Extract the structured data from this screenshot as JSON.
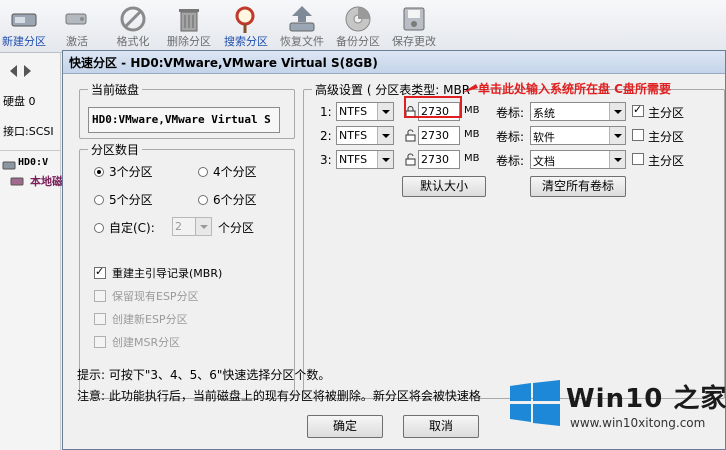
{
  "toolbar": {
    "items": [
      {
        "label": "新建分区",
        "icon": "new-partition-icon"
      },
      {
        "label": "激活",
        "icon": "activate-icon"
      },
      {
        "label": "格式化",
        "icon": "format-icon"
      },
      {
        "label": "删除分区",
        "icon": "delete-icon"
      },
      {
        "label": "搜索分区",
        "icon": "search-icon"
      },
      {
        "label": "恢复文件",
        "icon": "restore-icon"
      },
      {
        "label": "备份分区",
        "icon": "backup-icon"
      },
      {
        "label": "保存更改",
        "icon": "save-icon"
      }
    ]
  },
  "left_pane": {
    "disk_label": "硬盘 0",
    "interface_label": "接口:SCSI",
    "tree_disk": "HD0:V",
    "tree_local": "本地磁"
  },
  "dialog": {
    "title": "快速分区 - HD0:VMware,VMware Virtual S(8GB)",
    "current_disk": {
      "label": "当前磁盘",
      "value": "HD0:VMware,VMware Virtual S"
    },
    "partition_count": {
      "label": "分区数目",
      "options": [
        "3个分区",
        "4个分区",
        "5个分区",
        "6个分区"
      ],
      "selected": "3个分区",
      "custom_label": "自定(C):",
      "custom_value": "2",
      "custom_suffix": "个分区"
    },
    "options": [
      {
        "label": "重建主引导记录(MBR)",
        "checked": true,
        "enabled": true
      },
      {
        "label": "保留现有ESP分区",
        "checked": false,
        "enabled": false
      },
      {
        "label": "创建新ESP分区",
        "checked": false,
        "enabled": false
      },
      {
        "label": "创建MSR分区",
        "checked": false,
        "enabled": false
      }
    ],
    "advanced": {
      "label": "高级设置 ( 分区表类型: MBR",
      "rows": [
        {
          "num": "1:",
          "fs": "NTFS",
          "size": "2730",
          "unit": "MB",
          "vol_label": "卷标:",
          "volume": "系统",
          "primary_label": "主分区",
          "primary": true
        },
        {
          "num": "2:",
          "fs": "NTFS",
          "size": "2730",
          "unit": "MB",
          "vol_label": "卷标:",
          "volume": "软件",
          "primary_label": "主分区",
          "primary": false
        },
        {
          "num": "3:",
          "fs": "NTFS",
          "size": "2730",
          "unit": "MB",
          "vol_label": "卷标:",
          "volume": "文档",
          "primary_label": "主分区",
          "primary": false
        }
      ],
      "default_size_button": "默认大小",
      "clear_labels_button": "清空所有卷标"
    },
    "hint_line": "提示: 可按下\"3、4、5、6\"快速选择分区个数。",
    "warning_line": "注意: 此功能执行后，当前磁盘上的现有分区将被删除。新分区将会被快速格",
    "ok_button": "确定",
    "cancel_button": "取消"
  },
  "annotation": {
    "text": "单击此处输入系统所在盘 C盘所需要",
    "color": "#e02020"
  },
  "watermark": {
    "brand": "Win10 之家",
    "url": "www.win10xitong.com"
  }
}
